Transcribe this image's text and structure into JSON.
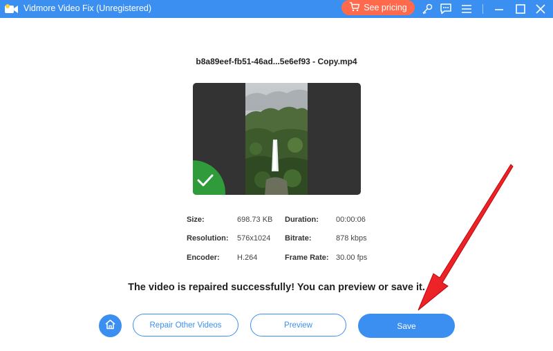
{
  "window": {
    "title": "Vidmore Video Fix (Unregistered)",
    "pricing_label": "See pricing",
    "icons": [
      "app-logo-icon",
      "cart-icon",
      "key-icon",
      "feedback-icon",
      "menu-icon",
      "minimize-icon",
      "maximize-icon",
      "close-icon"
    ]
  },
  "file": {
    "name": "b8a89eef-fb51-46ad...5e6ef93 - Copy.mp4",
    "status": "repaired"
  },
  "info": {
    "size_label": "Size:",
    "size_value": "698.73 KB",
    "duration_label": "Duration:",
    "duration_value": "00:00:06",
    "resolution_label": "Resolution:",
    "resolution_value": "576x1024",
    "bitrate_label": "Bitrate:",
    "bitrate_value": "878 kbps",
    "encoder_label": "Encoder:",
    "encoder_value": "H.264",
    "framerate_label": "Frame Rate:",
    "framerate_value": "30.00 fps"
  },
  "message": "The video is repaired successfully! You can preview or save it.",
  "buttons": {
    "repair_other": "Repair Other Videos",
    "preview": "Preview",
    "save": "Save"
  },
  "colors": {
    "accent": "#3b8ff0",
    "pricing": "#ff6a4d",
    "success": "#2f9b3a",
    "annotation_arrow": "#e8101a"
  }
}
